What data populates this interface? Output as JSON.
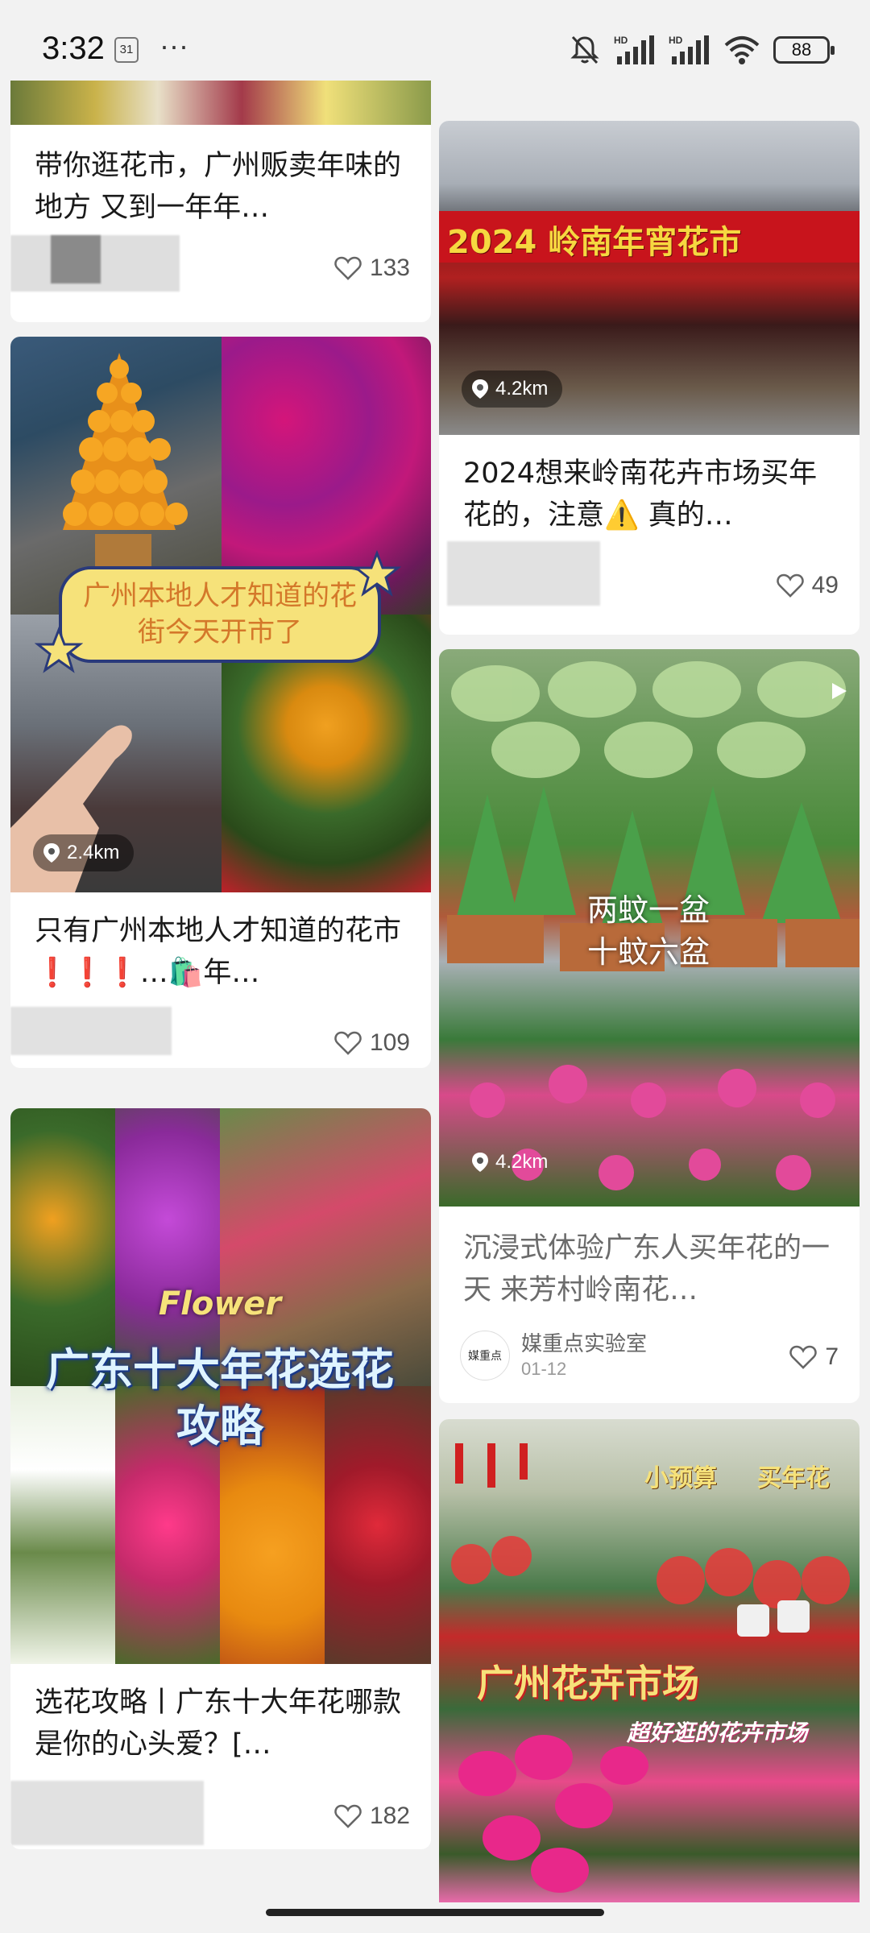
{
  "status_bar": {
    "time": "3:32",
    "calendar_day": "31",
    "more": "···",
    "battery": "88"
  },
  "feed": {
    "left": [
      {
        "title": "带你逛花市，广州贩卖年味的地方 又到一年年…",
        "likes": "133"
      },
      {
        "title": "只有广州本地人才知道的花市❗❗❗…🛍️年…",
        "likes": "109",
        "location": "2.4km",
        "image_caption": "广州本地人才知道的花街今天开市了"
      },
      {
        "title": "选花攻略丨广东十大年花哪款是你的心头爱？[…",
        "likes": "182",
        "image_caption_top": "Flower",
        "image_caption_main": "广东十大年花选花攻略"
      }
    ],
    "right": [
      {
        "title": "2024想来岭南花卉市场买年花的，注意⚠️ 真的…",
        "likes": "49",
        "location": "4.2km",
        "image_banner": "2024 岭南年宵花市"
      },
      {
        "title": "沉浸式体验广东人买年花的一天 来芳村岭南花…",
        "likes": "7",
        "location": "4.2km",
        "image_caption": "两蚊一盆\n十蚊六盆",
        "author": "媒重点实验室",
        "author_avatar": "媒重点",
        "date": "01-12"
      },
      {
        "image_caption_top_left": "小预算",
        "image_caption_top_right": "买年花",
        "image_caption_main": "广州花卉市场",
        "image_caption_sub": "超好逛的花卉市场"
      }
    ]
  }
}
